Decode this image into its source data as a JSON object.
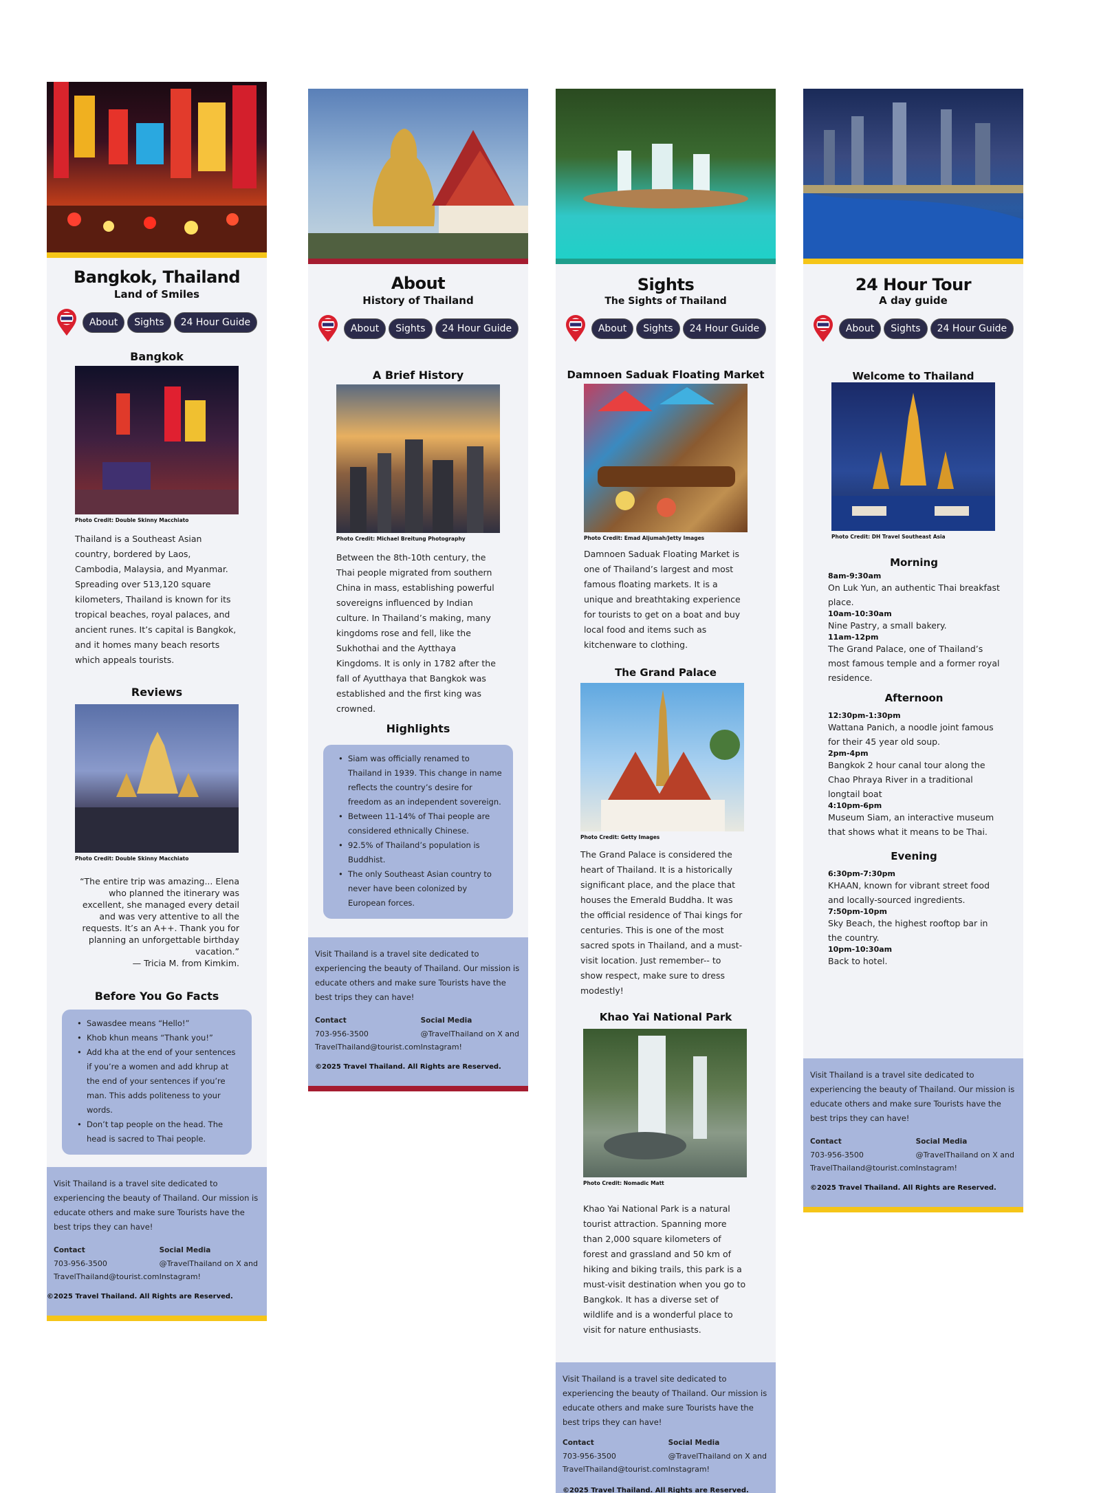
{
  "nav": {
    "about": "About",
    "sights": "Sights",
    "guide": "24 Hour Guide"
  },
  "colors": {
    "yellow": "#f5c518",
    "red": "#a51c30",
    "teal": "#1e9e8c",
    "footer": "#a8b6dc",
    "button": "#2b2b4a"
  },
  "footer": {
    "mission": "Visit Thailand is a travel site dedicated to experiencing the beauty of Thailand. Our mission is educate others and make sure Tourists have the best trips they can have!",
    "contact_label": "Contact",
    "phone": "703-956-3500",
    "email": "TravelThailand@tourist.com",
    "social_label": "Social Media",
    "social": "@TravelThailand on X and Instagram!",
    "copyright": "©2025 Travel Thailand. All Rights are Reserved."
  },
  "home": {
    "title": "Bangkok, Thailand",
    "subtitle": "Land of Smiles",
    "section1": "Bangkok",
    "credit1": "Photo Credit: Double Skinny Macchiato",
    "intro": "Thailand is a Southeast Asian country, bordered by Laos, Cambodia, Malaysia, and Myanmar. Spreading over 513,120 square kilometers, Thailand is known for its tropical beaches, royal palaces, and ancient runes. It’s capital is Bangkok, and it homes many beach resorts which appeals tourists.",
    "reviews": "Reviews",
    "credit2": "Photo Credit: Double Skinny Macchiato",
    "quote": "“The entire trip was amazing...  Elena who planned the itinerary was excellent, she managed every detail and was very attentive to all the requests. It’s an A++. Thank you for planning an unforgettable birthday vacation.”",
    "quote_author": "— Tricia M. from Kimkim.",
    "facts_title": "Before You Go Facts",
    "facts": [
      "Sawasdee means “Hello!”",
      "Khob khun means “Thank you!”",
      "Add kha at the end of your sentences if you’re a women and add khrup at the end of your sentences if you’re man. This adds politeness to your words.",
      "Don’t tap people on the head. The head is sacred to Thai people."
    ]
  },
  "about": {
    "title": "About",
    "subtitle": "History of Thailand",
    "section": "A Brief History",
    "credit": "Photo Credit: Michael Breitung Photography",
    "text": "Between the 8th-10th century, the Thai people migrated from southern China in mass, establishing powerful sovereigns influenced by Indian culture. In Thailand’s making, many kingdoms rose and fell, like the Sukhothai and the Aytthaya Kingdoms. It is only in 1782 after the fall of Ayutthaya that Bangkok was established and the first king was crowned.",
    "highlights": "Highlights",
    "bullets": [
      "Siam was officially renamed to Thailand in 1939. This change in name reflects the country’s desire for freedom as an independent sovereign.",
      "Between 11-14% of Thai people are considered ethnically Chinese.",
      "92.5% of Thailand’s population is Buddhist.",
      "The only Southeast Asian country to never have been colonized by European forces."
    ]
  },
  "sights": {
    "title": "Sights",
    "subtitle": "The Sights of Thailand",
    "s1": "Damnoen  Saduak Floating Market",
    "c1": "Photo Credit: Emad Aljumah/Jetty Images",
    "t1": "Damnoen Saduak Floating Market is one of Thailand’s largest and most famous floating markets. It is a unique and breathtaking experience for tourists to get on a boat and buy local food and items such as kitchenware to clothing.",
    "s2": "The Grand Palace",
    "c2": "Photo Credit: Getty Images",
    "t2": "The Grand Palace is considered the heart of Thailand. It is a historically significant place, and the place that houses the Emerald Buddha. It was the official residence of Thai kings for centuries. This is one of the most sacred spots in Thailand, and a must-visit location. Just remember-- to show respect, make sure to dress modestly!",
    "s3": "Khao Yai National Park",
    "c3": "Photo Credit: Nomadic Matt",
    "t3": "Khao Yai National Park is a natural tourist attraction. Spanning more than 2,000 square kilometers of forest and grassland and 50 km of hiking and biking trails, this park is a must-visit destination when you go to Bangkok. It has a diverse set of wildlife and is a wonderful place to visit for nature enthusiasts."
  },
  "tour": {
    "title": "24 Hour Tour",
    "subtitle": "A day guide",
    "welcome": "Welcome to Thailand",
    "credit": "Photo Credit: DH Travel Southeast Asia",
    "morning": "Morning",
    "m": [
      {
        "time": "8am-9:30am",
        "desc": "On Luk Yun, an authentic Thai breakfast place."
      },
      {
        "time": "10am-10:30am",
        "desc": "Nine Pastry, a small bakery."
      },
      {
        "time": "11am-12pm",
        "desc": "The Grand Palace, one of Thailand’s most famous temple and a former royal residence."
      }
    ],
    "afternoon": "Afternoon",
    "a": [
      {
        "time": "12:30pm-1:30pm",
        "desc": "Wattana Panich, a noodle joint famous for their 45 year old soup."
      },
      {
        "time": "2pm-4pm",
        "desc": "Bangkok 2 hour canal tour along the Chao Phraya River in a traditional longtail boat"
      },
      {
        "time": "4:10pm-6pm",
        "desc": "Museum Siam, an interactive museum that shows what it means to be Thai."
      }
    ],
    "evening": "Evening",
    "e": [
      {
        "time": "6:30pm-7:30pm",
        "desc": "KHAAN, known for vibrant street food and locally-sourced ingredients."
      },
      {
        "time": "7:50pm-10pm",
        "desc": "Sky Beach, the highest rooftop bar in the country."
      },
      {
        "time": "10pm-10:30am",
        "desc": "Back to hotel."
      }
    ]
  }
}
